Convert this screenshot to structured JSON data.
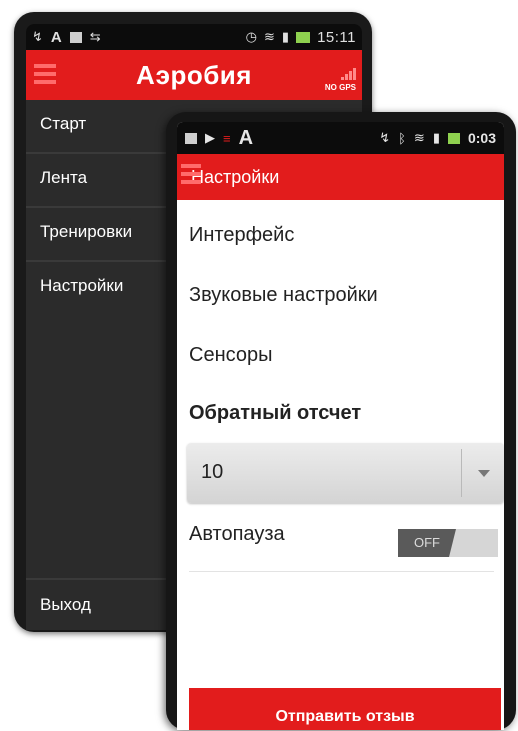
{
  "back_phone": {
    "status_time": "15:11",
    "app_title": "Аэробия",
    "gps_status": "NO GPS",
    "menu": [
      {
        "label": "Старт"
      },
      {
        "label": "Лента"
      },
      {
        "label": "Тренировки"
      },
      {
        "label": "Настройки"
      }
    ],
    "exit_label": "Выход"
  },
  "front_phone": {
    "status_time": "0:03",
    "screen_title": "Настройки",
    "items": [
      {
        "label": "Интерфейс"
      },
      {
        "label": "Звуковые настройки"
      },
      {
        "label": "Сенсоры"
      }
    ],
    "countdown": {
      "title": "Обратный отсчет",
      "value": "10"
    },
    "autopause": {
      "label": "Автопауза",
      "state": "OFF"
    },
    "feedback_label": "Отправить отзыв"
  },
  "colors": {
    "accent": "#e21c1c",
    "drawer_bg": "#2b2b2b",
    "status_bar": "#0c0c0c"
  }
}
